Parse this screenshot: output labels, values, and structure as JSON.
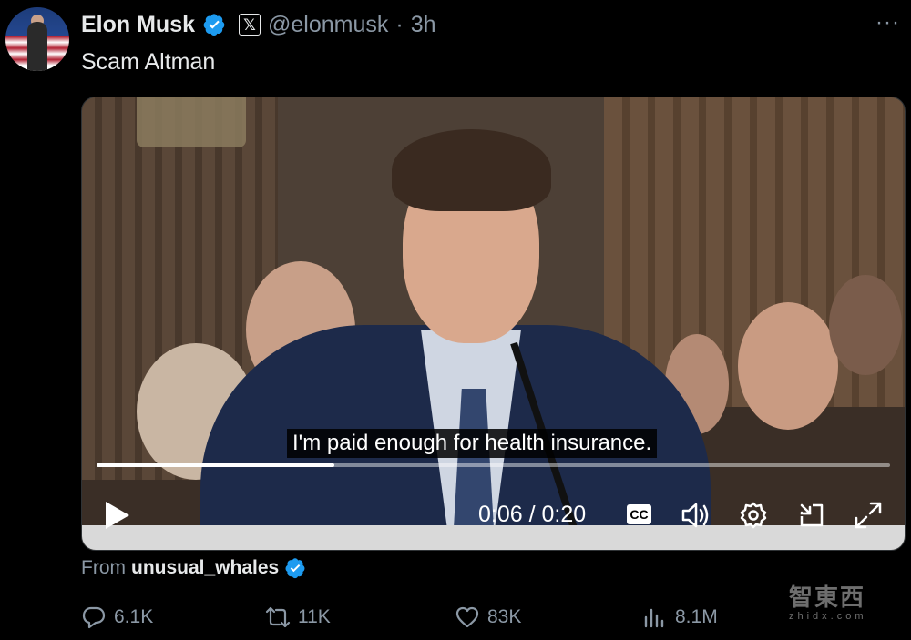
{
  "author": {
    "display_name": "Elon Musk",
    "handle": "@elonmusk",
    "separator": "·",
    "time": "3h",
    "verified_icon": "verified-badge-icon",
    "platform_badge": "𝕏"
  },
  "more_label": "···",
  "tweet": {
    "text": "Scam Altman"
  },
  "video": {
    "subtitle": "I'm paid enough for health insurance.",
    "current_time": "0:06",
    "duration": "0:20",
    "time_separator": "/",
    "progress": 0.3,
    "cc_label": "CC"
  },
  "source": {
    "prefix": "From",
    "name": "unusual_whales"
  },
  "actions": {
    "replies": "6.1K",
    "reposts": "11K",
    "likes": "83K",
    "views": "8.1M"
  },
  "watermark": {
    "text": "智東西",
    "sub": "zhidx.com"
  },
  "colors": {
    "background": "#000000",
    "primary_text": "#e7e9ea",
    "secondary_text": "#8b98a5",
    "verified_blue": "#1d9bf0"
  }
}
